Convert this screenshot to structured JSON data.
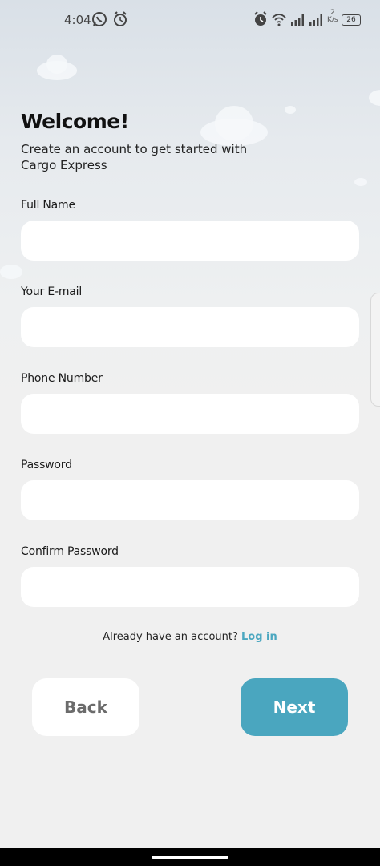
{
  "status_bar": {
    "time": "4:04",
    "network_speed": "2",
    "network_unit": "K/s",
    "battery": "26"
  },
  "header": {
    "title": "Welcome!",
    "subtitle": "Create an account to get started with Cargo Express"
  },
  "form": {
    "full_name": {
      "label": "Full Name",
      "value": ""
    },
    "email": {
      "label": "Your E-mail",
      "value": ""
    },
    "phone": {
      "label": "Phone Number",
      "value": ""
    },
    "password": {
      "label": "Password",
      "value": ""
    },
    "confirm_password": {
      "label": "Confirm Password",
      "value": ""
    }
  },
  "login_prompt": {
    "text": "Already have an account?",
    "link": "Log in"
  },
  "buttons": {
    "back": "Back",
    "next": "Next"
  },
  "colors": {
    "accent": "#4aa6bf",
    "link": "#4ba7c0",
    "background": "#f0f0f0"
  }
}
